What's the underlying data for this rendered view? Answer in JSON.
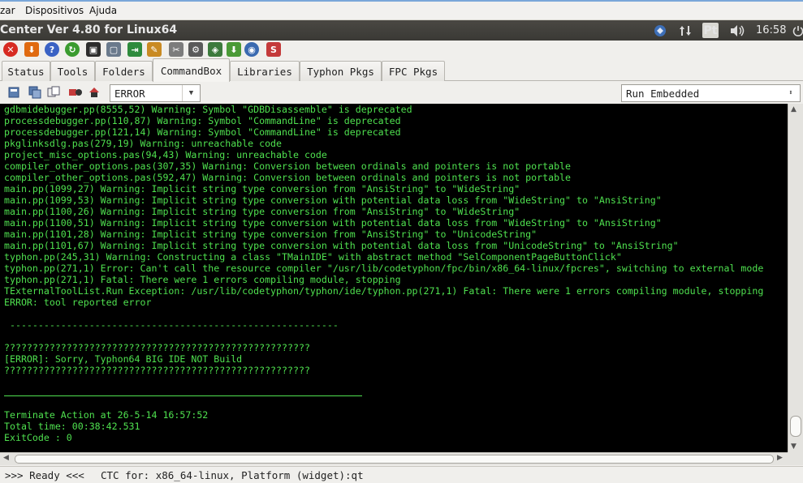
{
  "menu": {
    "items": [
      "zar",
      "Dispositivos",
      "Ajuda"
    ]
  },
  "titlebar": {
    "title": "Center Ver 4.80 for Linux64",
    "lang": "Pt",
    "time": "16:58"
  },
  "icons": {
    "toolbar": [
      "close-red-icon",
      "download-icon",
      "help-icon",
      "refresh-icon",
      "terminal-icon",
      "frame-icon",
      "login-icon",
      "edit-icon",
      "tools-icon",
      "settings-icon",
      "chip-icon",
      "globe-download-icon",
      "gauge-icon",
      "package-64-icon"
    ]
  },
  "tabs": [
    "Status",
    "Tools",
    "Folders",
    "CommandBox",
    "Libraries",
    "Typhon Pkgs",
    "FPC Pkgs"
  ],
  "subbar": {
    "filter_value": "ERROR",
    "mode_value": "Run Embedded"
  },
  "console": {
    "lines": [
      "gdbmidebugger.pp(8555,52) Warning: Symbol \"GDBDisassemble\" is deprecated",
      "processdebugger.pp(110,87) Warning: Symbol \"CommandLine\" is deprecated",
      "processdebugger.pp(121,14) Warning: Symbol \"CommandLine\" is deprecated",
      "pkglinksdlg.pas(279,19) Warning: unreachable code",
      "project_misc_options.pas(94,43) Warning: unreachable code",
      "compiler_other_options.pas(307,35) Warning: Conversion between ordinals and pointers is not portable",
      "compiler_other_options.pas(592,47) Warning: Conversion between ordinals and pointers is not portable",
      "main.pp(1099,27) Warning: Implicit string type conversion from \"AnsiString\" to \"WideString\"",
      "main.pp(1099,53) Warning: Implicit string type conversion with potential data loss from \"WideString\" to \"AnsiString\"",
      "main.pp(1100,26) Warning: Implicit string type conversion from \"AnsiString\" to \"WideString\"",
      "main.pp(1100,51) Warning: Implicit string type conversion with potential data loss from \"WideString\" to \"AnsiString\"",
      "main.pp(1101,28) Warning: Implicit string type conversion from \"AnsiString\" to \"UnicodeString\"",
      "main.pp(1101,67) Warning: Implicit string type conversion with potential data loss from \"UnicodeString\" to \"AnsiString\"",
      "typhon.pp(245,31) Warning: Constructing a class \"TMainIDE\" with abstract method \"SelComponentPageButtonClick\"",
      "typhon.pp(271,1) Error: Can't call the resource compiler \"/usr/lib/codetyphon/fpc/bin/x86_64-linux/fpcres\", switching to external mode",
      "typhon.pp(271,1) Fatal: There were 1 errors compiling module, stopping",
      "TExternalToolList.Run Exception: /usr/lib/codetyphon/typhon/ide/typhon.pp(271,1) Fatal: There were 1 errors compiling module, stopping",
      "ERROR: tool reported error",
      "",
      " ----------------------------------------------------------",
      "",
      "??????????????????????????????????????????????????????",
      "[ERROR]: Sorry, Typhon64 BIG IDE NOT Build",
      "??????????????????????????????????????????????????????",
      "",
      "",
      "",
      "Terminate Action at 26-5-14 16:57:52",
      "Total time: 00:38:42.531",
      "ExitCode : 0"
    ]
  },
  "status": {
    "ready": ">>> Ready <<<",
    "info": "CTC for: x86_64-linux, Platform (widget):qt"
  }
}
